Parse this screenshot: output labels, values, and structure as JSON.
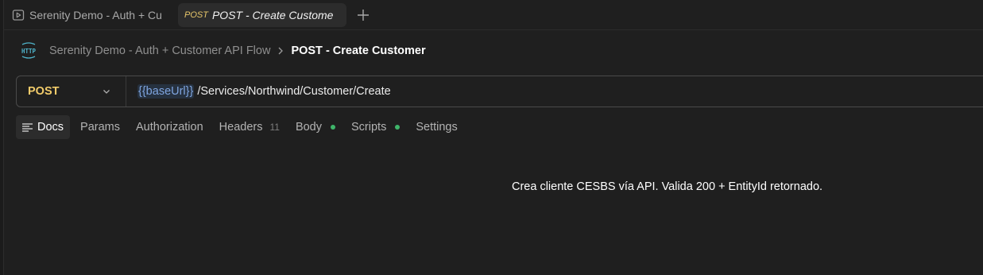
{
  "tabs": {
    "collection_tab_label": "Serenity Demo - Auth + Cu",
    "active_tab_method": "POST",
    "active_tab_label": "POST - Create Custome",
    "add_tab_label": "+"
  },
  "breadcrumb": {
    "parent": "Serenity Demo - Auth + Customer API Flow",
    "current": "POST - Create Customer"
  },
  "request": {
    "method": "POST",
    "url_variable": "{{baseUrl}}",
    "url_path": "/Services/Northwind/Customer/Create"
  },
  "request_tabs": [
    {
      "label": "Docs",
      "active": true
    },
    {
      "label": "Params"
    },
    {
      "label": "Authorization"
    },
    {
      "label": "Headers",
      "count": "11"
    },
    {
      "label": "Body",
      "status_dot": true
    },
    {
      "label": "Scripts",
      "status_dot": true
    },
    {
      "label": "Settings"
    }
  ],
  "docs": {
    "description": "Crea cliente CESBS vía API. Valida 200 + EntityId retornado."
  },
  "colors": {
    "background": "#1f1f1f",
    "method_post": "#f1cb6a",
    "url_variable": "#7fa5e0",
    "status_dot": "#3fb56a"
  },
  "icons": [
    "play-icon",
    "http-icon",
    "chevron-right-icon",
    "chevron-down-icon",
    "docs-lines-icon",
    "plus-icon"
  ]
}
